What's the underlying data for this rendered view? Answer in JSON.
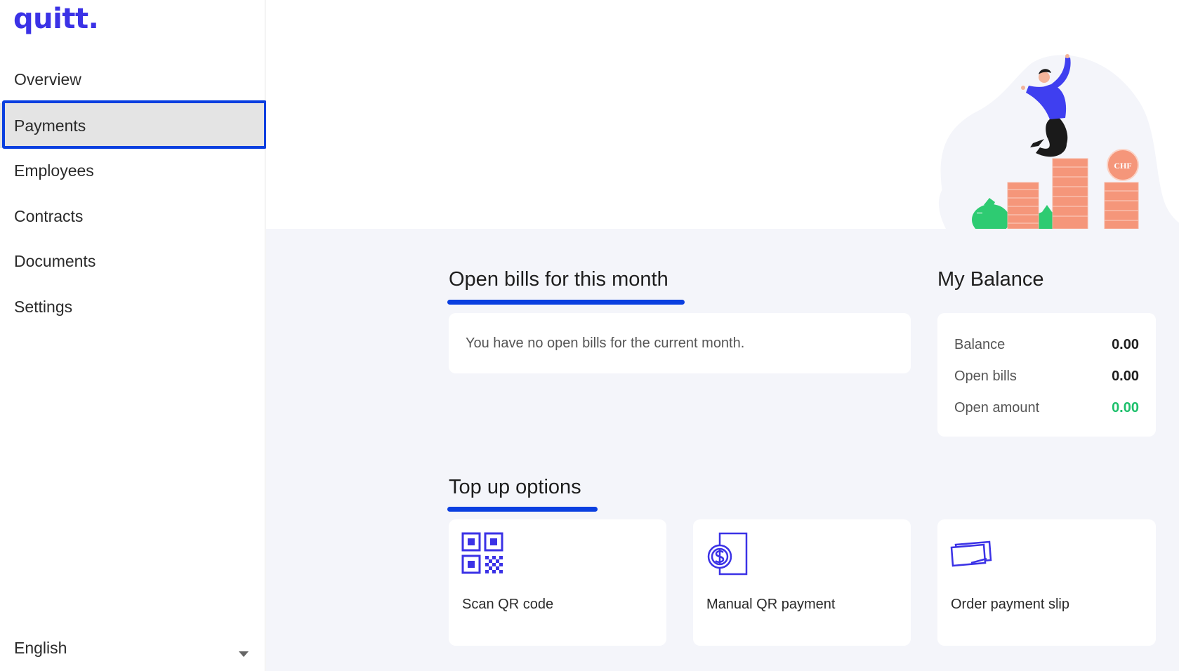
{
  "app": {
    "logo": "quitt."
  },
  "sidebar": {
    "items": [
      {
        "label": "Overview"
      },
      {
        "label": "Payments",
        "active": true
      },
      {
        "label": "Employees"
      },
      {
        "label": "Contracts"
      },
      {
        "label": "Documents"
      },
      {
        "label": "Settings"
      }
    ],
    "language": "English"
  },
  "hero": {
    "coin_label": "CHF"
  },
  "open_bills": {
    "title": "Open bills for this month",
    "empty_message": "You have no open bills for the current month."
  },
  "balance": {
    "title": "My Balance",
    "rows": [
      {
        "label": "Balance",
        "value": "0.00"
      },
      {
        "label": "Open bills",
        "value": "0.00"
      },
      {
        "label": "Open amount",
        "value": "0.00",
        "color": "#1ec06c"
      }
    ]
  },
  "top_up": {
    "title": "Top up options",
    "options": [
      {
        "label": "Scan QR code",
        "icon": "qr-code-icon"
      },
      {
        "label": "Manual QR payment",
        "icon": "dollar-document-icon"
      },
      {
        "label": "Order payment slip",
        "icon": "payment-slip-icon"
      }
    ]
  },
  "colors": {
    "accent": "#0a3fe0",
    "brand": "#3b32e6",
    "positive": "#1ec06c"
  }
}
